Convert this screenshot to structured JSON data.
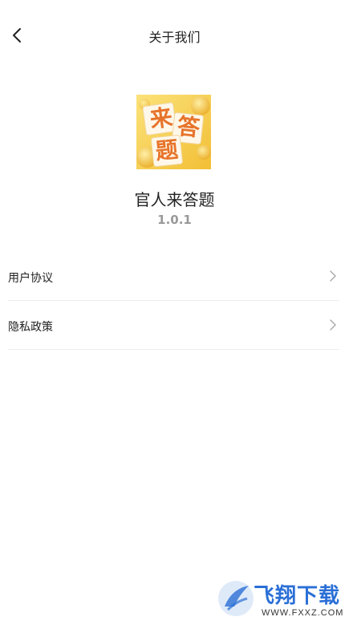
{
  "header": {
    "title": "关于我们"
  },
  "app": {
    "icon_chars": [
      "来",
      "答",
      "题"
    ],
    "name": "官人来答题",
    "version": "1.0.1"
  },
  "menu": [
    {
      "label": "用户协议"
    },
    {
      "label": "隐私政策"
    }
  ],
  "watermark": {
    "brand": "飞翔下载",
    "url": "WWW.FXXZ.COM"
  },
  "colors": {
    "icon_bg": "#f6cf4c",
    "icon_text": "#e7742b",
    "version_text": "#999999",
    "divider": "#ececec",
    "watermark_blue": "#2a6fd6"
  }
}
